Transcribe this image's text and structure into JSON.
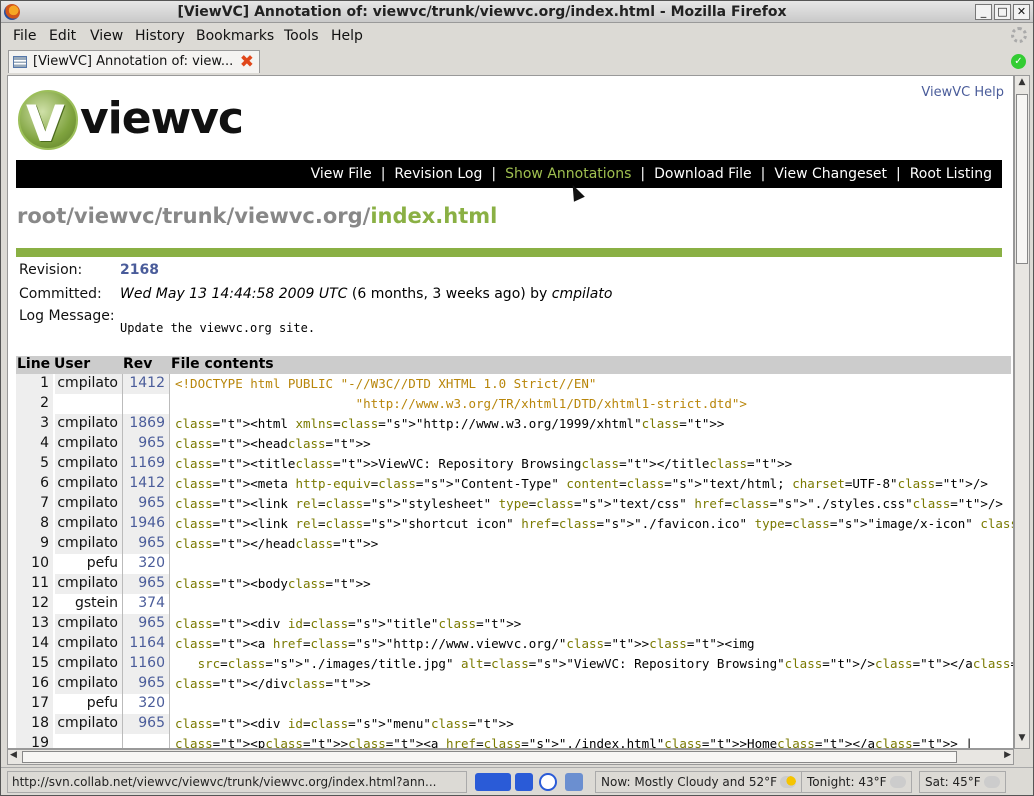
{
  "window": {
    "title": "[ViewVC] Annotation of: viewvc/trunk/viewvc.org/index.html - Mozilla Firefox",
    "controls": [
      "_",
      "□",
      "✕"
    ]
  },
  "menu": [
    "File",
    "Edit",
    "View",
    "History",
    "Bookmarks",
    "Tools",
    "Help"
  ],
  "tab": {
    "label": "[ViewVC] Annotation of: view..."
  },
  "page": {
    "help_link": "ViewVC Help",
    "logo_text": "viewvc",
    "nav": [
      {
        "label": "View File",
        "active": false
      },
      {
        "label": "Revision Log",
        "active": false
      },
      {
        "label": "Show Annotations",
        "active": true
      },
      {
        "label": "Download File",
        "active": false
      },
      {
        "label": "View Changeset",
        "active": false
      },
      {
        "label": "Root Listing",
        "active": false
      }
    ],
    "nav_separator": "|",
    "path_prefix": "root/viewvc/trunk/viewvc.org/",
    "path_leaf": "index.html",
    "meta": {
      "revision_label": "Revision:",
      "revision": "2168",
      "committed_label": "Committed:",
      "committed_date": "Wed May 13 14:44:58 2009 UTC",
      "committed_age": " (6 months, 3 weeks ago) by ",
      "committed_by": "cmpilato",
      "log_label": "Log Message:",
      "log_message": "Update the viewvc.org site."
    },
    "table_headers": {
      "line": "Line",
      "user": "User",
      "rev": "Rev",
      "contents": "File contents"
    },
    "annotations": [
      {
        "line": "1",
        "user": "cmpilato",
        "rev": "1412"
      },
      {
        "line": "2",
        "user": "",
        "rev": ""
      },
      {
        "line": "3",
        "user": "cmpilato",
        "rev": "1869"
      },
      {
        "line": "4",
        "user": "cmpilato",
        "rev": "965"
      },
      {
        "line": "5",
        "user": "cmpilato",
        "rev": "1169"
      },
      {
        "line": "6",
        "user": "cmpilato",
        "rev": "1412"
      },
      {
        "line": "7",
        "user": "cmpilato",
        "rev": "965"
      },
      {
        "line": "8",
        "user": "cmpilato",
        "rev": "1946"
      },
      {
        "line": "9",
        "user": "cmpilato",
        "rev": "965"
      },
      {
        "line": "10",
        "user": "pefu",
        "rev": "320"
      },
      {
        "line": "11",
        "user": "cmpilato",
        "rev": "965"
      },
      {
        "line": "12",
        "user": "gstein",
        "rev": "374"
      },
      {
        "line": "13",
        "user": "cmpilato",
        "rev": "965"
      },
      {
        "line": "14",
        "user": "cmpilato",
        "rev": "1164"
      },
      {
        "line": "15",
        "user": "cmpilato",
        "rev": "1160"
      },
      {
        "line": "16",
        "user": "cmpilato",
        "rev": "965"
      },
      {
        "line": "17",
        "user": "pefu",
        "rev": "320"
      },
      {
        "line": "18",
        "user": "cmpilato",
        "rev": "965"
      },
      {
        "line": "19",
        "user": "",
        "rev": ""
      }
    ],
    "code_lines": [
      "<!DOCTYPE html PUBLIC \"-//W3C//DTD XHTML 1.0 Strict//EN\"",
      "                        \"http://www.w3.org/TR/xhtml1/DTD/xhtml1-strict.dtd\">",
      "<html xmlns=\"http://www.w3.org/1999/xhtml\">",
      "<head>",
      "<title>ViewVC: Repository Browsing</title>",
      "<meta http-equiv=\"Content-Type\" content=\"text/html; charset=UTF-8\"/>",
      "<link rel=\"stylesheet\" type=\"text/css\" href=\"./styles.css\"/>",
      "<link rel=\"shortcut icon\" href=\"./favicon.ico\" type=\"image/x-icon\" />",
      "</head>",
      "",
      "<body>",
      "",
      "<div id=\"title\">",
      "<a href=\"http://www.viewvc.org/\"><img",
      "   src=\"./images/title.jpg\" alt=\"ViewVC: Repository Browsing\"/></a>",
      "</div>",
      "",
      "<div id=\"menu\">",
      "<p><a href=\"./index.html\">Home</a> |"
    ]
  },
  "status": {
    "url": "http://svn.collab.net/viewvc/viewvc/trunk/viewvc.org/index.html?ann...",
    "weather_now": "Now: Mostly Cloudy and 52°F",
    "weather_tonight": "Tonight: 43°F",
    "weather_sat": "Sat: 45°F"
  },
  "colors": {
    "accent_green": "#8ab044",
    "link_blue": "#4a5c9a",
    "nav_bg": "#000000"
  }
}
